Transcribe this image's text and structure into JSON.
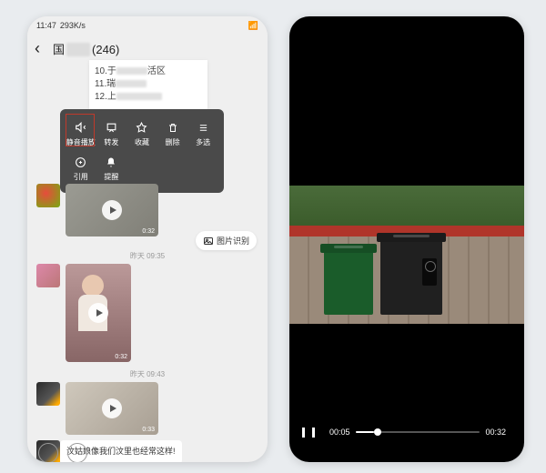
{
  "statusbar": {
    "time": "11:47",
    "net": "293K/s"
  },
  "header": {
    "prefix": "国",
    "count": "(246)"
  },
  "list": {
    "r1": {
      "n": "10",
      "t": "于",
      "s": "活区"
    },
    "r2": {
      "n": "11",
      "t": "瑞"
    },
    "r3": {
      "n": "12",
      "t": "上"
    }
  },
  "menu": {
    "mute": "静音播放",
    "forward": "转发",
    "fav": "收藏",
    "del": "删除",
    "multi": "多选",
    "quote": "引用",
    "remind": "提醒"
  },
  "videos": {
    "d1": "0:32",
    "d2": "0:32",
    "d3": "0:33"
  },
  "timestamps": {
    "t1": "昨天 09:35",
    "t2": "昨天 09:43"
  },
  "chip": "图片识别",
  "text_msg": "汶姑娘像我们汶里也经常这样!",
  "player": {
    "cur": "00:05",
    "total": "00:32"
  }
}
